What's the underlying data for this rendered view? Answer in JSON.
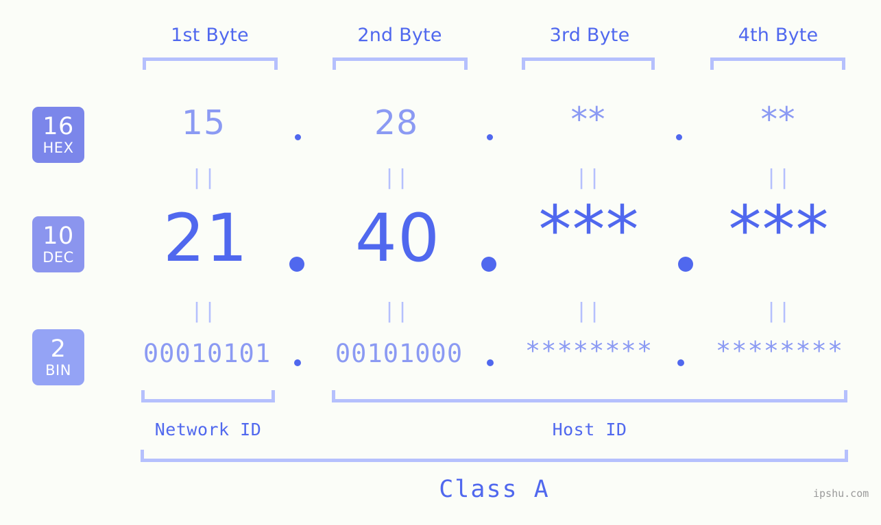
{
  "page": {
    "background_color": "#fbfdf8",
    "accent_strong": "#5068ee",
    "accent_light": "#8b9af3",
    "accent_pale": "#b5c0fd",
    "watermark": "ipshu.com"
  },
  "byte_headers": [
    {
      "label": "1st Byte"
    },
    {
      "label": "2nd Byte"
    },
    {
      "label": "3rd Byte"
    },
    {
      "label": "4th Byte"
    }
  ],
  "bases": [
    {
      "number": "16",
      "unit": "HEX",
      "color": "#7b86ea"
    },
    {
      "number": "10",
      "unit": "DEC",
      "color": "#8b95ee"
    },
    {
      "number": "2",
      "unit": "BIN",
      "color": "#94a3f5"
    }
  ],
  "rows": {
    "hex": {
      "base_number": "16",
      "base_unit": "HEX",
      "values": [
        "15",
        "28",
        "**",
        "**"
      ],
      "separator": "."
    },
    "dec": {
      "base_number": "10",
      "base_unit": "DEC",
      "values": [
        "21",
        "40",
        "***",
        "***"
      ],
      "separator": "."
    },
    "bin": {
      "base_number": "2",
      "base_unit": "BIN",
      "values": [
        "00010101",
        "00101000",
        "********",
        "********"
      ],
      "separator": "."
    }
  },
  "equals_marks": {
    "glyph": "||",
    "count_per_row": 4
  },
  "segments": {
    "network_id": "Network ID",
    "host_id": "Host ID",
    "class": "Class A"
  }
}
